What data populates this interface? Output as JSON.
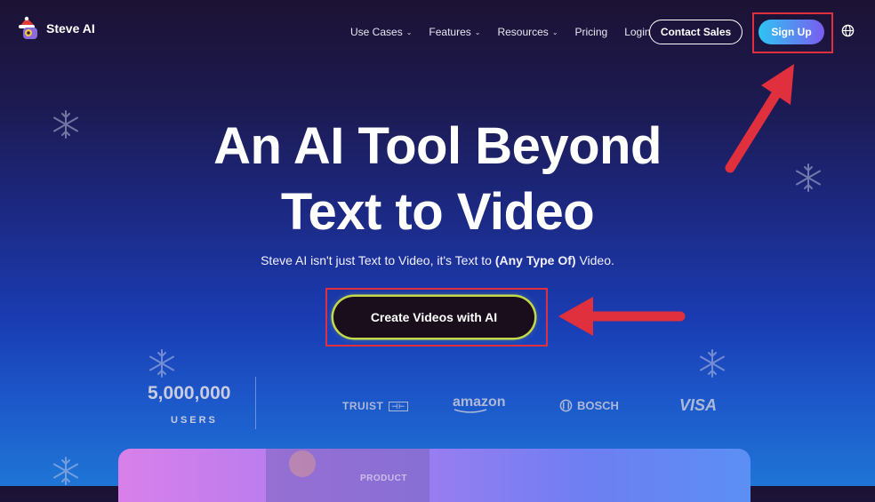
{
  "logo": {
    "text": "Steve AI",
    "icon": "steve-ai-logo-icon"
  },
  "nav": {
    "items": [
      {
        "label": "Use Cases",
        "has_dropdown": true
      },
      {
        "label": "Features",
        "has_dropdown": true
      },
      {
        "label": "Resources",
        "has_dropdown": true
      },
      {
        "label": "Pricing",
        "has_dropdown": false
      },
      {
        "label": "Login",
        "has_dropdown": false
      }
    ],
    "contact_label": "Contact Sales",
    "signup_label": "Sign Up",
    "language_icon": "globe-icon"
  },
  "hero": {
    "title_line1": "An AI Tool Beyond",
    "title_line2": "Text to Video",
    "subtitle_start": "Steve AI isn't just Text to Video, it's Text to ",
    "subtitle_bold": "(Any Type Of)",
    "subtitle_end": " Video.",
    "cta_label": "Create Videos with AI"
  },
  "stats": {
    "users_count": "5,000,000",
    "users_label": "USERS"
  },
  "brands": [
    "TRUIST",
    "amazon",
    "BOSCH",
    "VISA"
  ],
  "preview": {
    "label": "PRODUCT"
  },
  "colors": {
    "accent_red": "#e0303e",
    "signup_gradient_start": "#2ec4f2",
    "signup_gradient_end": "#7b5cf0",
    "cta_glow": "#c4d94a"
  }
}
